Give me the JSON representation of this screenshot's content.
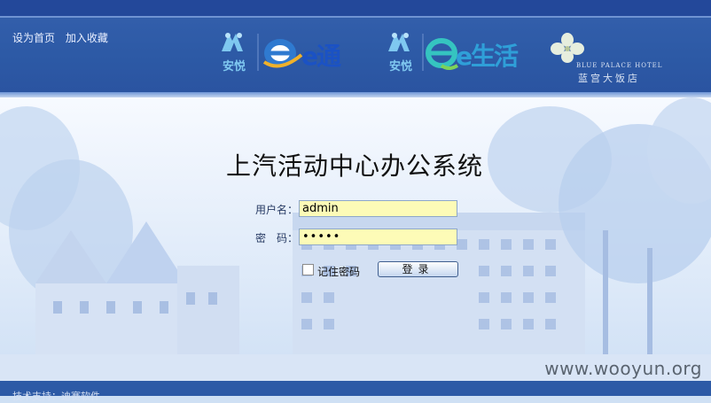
{
  "header": {
    "links": [
      "设为首页",
      "加入收藏"
    ],
    "logos": [
      {
        "name": "anyue-logo",
        "text": "安悦"
      },
      {
        "name": "etong-logo",
        "text": "e通"
      },
      {
        "name": "anyue-logo-2",
        "text": "安悦"
      },
      {
        "name": "eshenghuo-logo",
        "text": "e生活"
      },
      {
        "name": "blue-palace-logo",
        "en": "BLUE PALACE HOTEL",
        "cn": "蓝宫大饭店"
      }
    ]
  },
  "login": {
    "title": "上汽活动中心办公系统",
    "username_label": "用户名：",
    "username_value": "admin",
    "password_label": "密　码：",
    "password_value": "•••••",
    "remember_label": "记住密码",
    "login_button": "登录"
  },
  "watermark": "www.wooyun.org",
  "footer": {
    "text": "技术支持：迪赛软件"
  },
  "colors": {
    "header_blue": "#2d5aa6",
    "input_yellow": "#fdfbb7",
    "accent_cyan": "#7fc8f0"
  }
}
